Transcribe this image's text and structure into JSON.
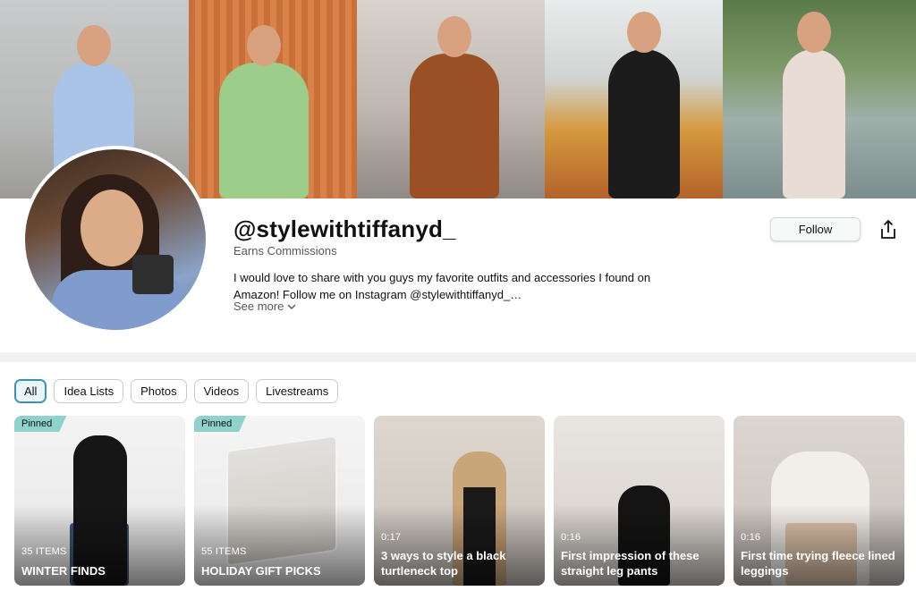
{
  "profile": {
    "handle": "@stylewithtiffanyd_",
    "subtitle": "Earns Commissions",
    "bio": "I would love to share with you guys my favorite outfits and accessories I found on Amazon! Follow me on Instagram @stylewithtiffanyd_…",
    "see_more": "See more",
    "follow_label": "Follow"
  },
  "filters": [
    "All",
    "Idea Lists",
    "Photos",
    "Videos",
    "Livestreams"
  ],
  "active_filter": "All",
  "tiles": [
    {
      "badge": "Pinned",
      "meta": "35 ITEMS",
      "title": "WINTER FINDS"
    },
    {
      "badge": "Pinned",
      "meta": "55 ITEMS",
      "title": "HOLIDAY GIFT PICKS"
    },
    {
      "meta": "0:17",
      "title": "3 ways to style a black turtleneck top"
    },
    {
      "meta": "0:16",
      "title": "First impression of these straight leg pants"
    },
    {
      "meta": "0:16",
      "title": "First time trying fleece lined leggings"
    }
  ],
  "icons": {
    "share": "share-icon",
    "chevron": "chevron-down-icon"
  },
  "colors": {
    "active_chip_border": "#3d8fb3",
    "pinned_badge": "#8fd1cb",
    "background": "#f0f2f2"
  }
}
